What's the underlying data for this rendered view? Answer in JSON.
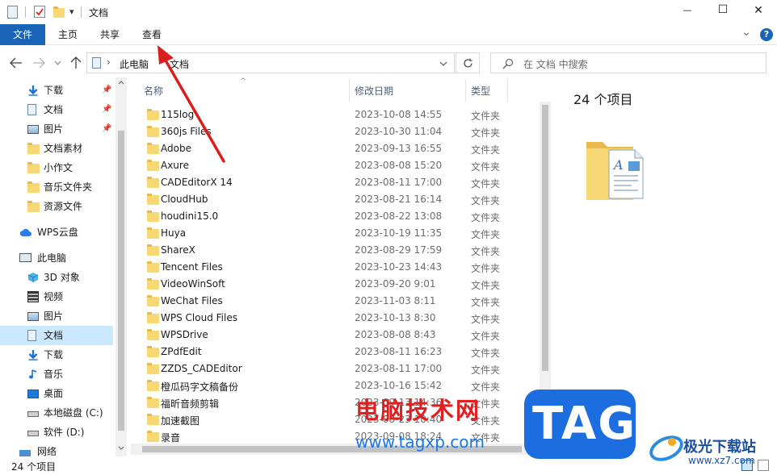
{
  "titlebar": {
    "title": "文档",
    "qat_dropdown": "▾",
    "minimize": "—",
    "maximize": "☐",
    "close": "✕"
  },
  "ribbon": {
    "tabs": [
      {
        "label": "文件",
        "active": true
      },
      {
        "label": "主页"
      },
      {
        "label": "共享"
      },
      {
        "label": "查看"
      }
    ],
    "collapse_glyph": "⌄",
    "help_glyph": "?"
  },
  "address": {
    "path": [
      "此电脑",
      "文档"
    ],
    "separator": "›",
    "search_placeholder": "在 文档 中搜索"
  },
  "nav": {
    "quick_access": [
      {
        "label": "下载",
        "icon": "download-icon",
        "pinned": true
      },
      {
        "label": "文档",
        "icon": "document-icon",
        "pinned": true
      },
      {
        "label": "图片",
        "icon": "picture-icon",
        "pinned": true
      },
      {
        "label": "文档素材",
        "icon": "folder-icon"
      },
      {
        "label": "小作文",
        "icon": "folder-icon"
      },
      {
        "label": "音乐文件夹",
        "icon": "folder-icon"
      },
      {
        "label": "资源文件",
        "icon": "folder-icon"
      }
    ],
    "wps_cloud": {
      "label": "WPS云盘",
      "icon": "cloud-icon"
    },
    "this_pc": {
      "label": "此电脑",
      "icon": "computer-icon"
    },
    "pc_items": [
      {
        "label": "3D 对象",
        "icon": "cube-icon"
      },
      {
        "label": "视频",
        "icon": "video-icon"
      },
      {
        "label": "图片",
        "icon": "picture-icon"
      },
      {
        "label": "文档",
        "icon": "document-icon",
        "selected": true
      },
      {
        "label": "下载",
        "icon": "download-icon"
      },
      {
        "label": "音乐",
        "icon": "music-icon"
      },
      {
        "label": "桌面",
        "icon": "desktop-icon"
      },
      {
        "label": "本地磁盘 (C:)",
        "icon": "drive-icon"
      },
      {
        "label": "软件 (D:)",
        "icon": "drive-icon"
      },
      {
        "label": "网络",
        "icon": "network-icon"
      }
    ]
  },
  "filelist": {
    "columns": {
      "name": "名称",
      "date": "修改日期",
      "type": "类型"
    },
    "rows": [
      {
        "name": "115log",
        "date": "2023-10-08 14:55",
        "type": "文件夹"
      },
      {
        "name": "360js Files",
        "date": "2023-10-30 11:04",
        "type": "文件夹"
      },
      {
        "name": "Adobe",
        "date": "2023-09-13 16:55",
        "type": "文件夹"
      },
      {
        "name": "Axure",
        "date": "2023-08-08 15:20",
        "type": "文件夹"
      },
      {
        "name": "CADEditorX 14",
        "date": "2023-08-11 17:00",
        "type": "文件夹"
      },
      {
        "name": "CloudHub",
        "date": "2023-08-21 16:14",
        "type": "文件夹"
      },
      {
        "name": "houdini15.0",
        "date": "2023-08-22 13:08",
        "type": "文件夹"
      },
      {
        "name": "Huya",
        "date": "2023-10-19 11:35",
        "type": "文件夹"
      },
      {
        "name": "ShareX",
        "date": "2023-08-29 17:59",
        "type": "文件夹"
      },
      {
        "name": "Tencent Files",
        "date": "2023-10-23 14:43",
        "type": "文件夹"
      },
      {
        "name": "VideoWinSoft",
        "date": "2023-09-20 9:01",
        "type": "文件夹"
      },
      {
        "name": "WeChat Files",
        "date": "2023-11-03 8:11",
        "type": "文件夹"
      },
      {
        "name": "WPS Cloud Files",
        "date": "2023-10-13 8:30",
        "type": "文件夹"
      },
      {
        "name": "WPSDrive",
        "date": "2023-08-08 8:43",
        "type": "文件夹"
      },
      {
        "name": "ZPdfEdit",
        "date": "2023-08-11 16:23",
        "type": "文件夹"
      },
      {
        "name": "ZZDS_CADEditor",
        "date": "2023-08-11 17:00",
        "type": "文件夹"
      },
      {
        "name": "橙瓜码字文稿备份",
        "date": "2023-10-16 15:42",
        "type": "文件夹"
      },
      {
        "name": "福昕音频剪辑",
        "date": "2023-09-13 14:36",
        "type": "文件夹"
      },
      {
        "name": "加速截图",
        "date": "2023-08-23 10:40",
        "type": "文件夹"
      },
      {
        "name": "录音",
        "date": "2023-09-08 18:24",
        "type": "文件夹"
      }
    ]
  },
  "preview": {
    "count": "24 个项目"
  },
  "status": {
    "count": "24 个项目"
  },
  "watermark": {
    "site_cn": "电脑技术网",
    "site_url": "www.tagxp.com",
    "tag": "TAG",
    "brand2": "极光下载站",
    "brand2_url": "www.xz7.com"
  },
  "colors": {
    "accent": "#1a64b8",
    "folder": "#f8d775",
    "selected": "#cce8ff",
    "arrow": "#d81e1e"
  }
}
